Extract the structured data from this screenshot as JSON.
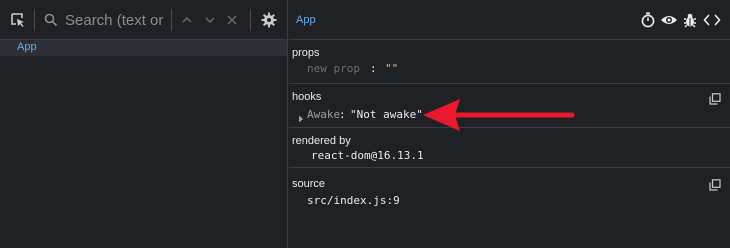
{
  "search": {
    "placeholder": "Search (text or /re"
  },
  "tree": {
    "items": [
      {
        "label": "App"
      }
    ]
  },
  "inspector": {
    "component_name": "App",
    "props": {
      "title": "props",
      "new_prop": "new prop",
      "colon": ":",
      "value": "\"\""
    },
    "hooks": {
      "title": "hooks",
      "name": "Awake",
      "colon": ":",
      "value": "\"Not awake\""
    },
    "rendered_by": {
      "title": "rendered by",
      "value": "react-dom@16.13.1"
    },
    "source": {
      "title": "source",
      "value": "src/index.js:9"
    }
  },
  "icons": {
    "select_element": "select-element-icon",
    "search": "search-icon",
    "up": "chevron-up-icon",
    "down": "chevron-down-icon",
    "clear": "close-icon",
    "settings": "gear-icon",
    "stopwatch": "stopwatch-icon",
    "eye": "eye-icon",
    "bug": "bug-icon",
    "source": "code-icon",
    "copy": "copy-icon",
    "expand": "expand-triangle-icon",
    "annotation": "red-arrow"
  },
  "colors": {
    "background": "#202124",
    "accent_blue": "#61afef",
    "annotation_red": "#e8192c"
  }
}
